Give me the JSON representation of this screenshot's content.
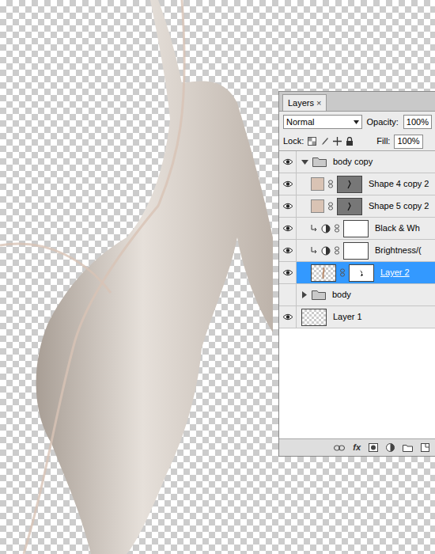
{
  "panel": {
    "tab": "Layers",
    "close": "×",
    "blend_mode": "Normal",
    "opacity_label": "Opacity:",
    "opacity": "100%",
    "lock_label": "Lock:",
    "fill_label": "Fill:",
    "fill": "100%"
  },
  "layers": [
    {
      "name": "body copy",
      "kind": "group",
      "visible": true,
      "expanded": true,
      "selected": false,
      "in_group": false,
      "clipped": false
    },
    {
      "name": "Shape 4 copy 2",
      "kind": "shape",
      "visible": true,
      "expanded": false,
      "selected": false,
      "in_group": true,
      "clipped": false
    },
    {
      "name": "Shape 5 copy 2",
      "kind": "shape",
      "visible": true,
      "expanded": false,
      "selected": false,
      "in_group": true,
      "clipped": false
    },
    {
      "name": "Black & Wh",
      "kind": "adjustment",
      "visible": true,
      "expanded": false,
      "selected": false,
      "in_group": true,
      "clipped": true
    },
    {
      "name": "Brightness/(",
      "kind": "adjustment",
      "visible": true,
      "expanded": false,
      "selected": false,
      "in_group": true,
      "clipped": true
    },
    {
      "name": "Layer 2",
      "kind": "pixel",
      "visible": true,
      "expanded": false,
      "selected": true,
      "in_group": true,
      "clipped": false
    },
    {
      "name": "body",
      "kind": "group",
      "visible": false,
      "expanded": false,
      "selected": false,
      "in_group": false,
      "clipped": false
    },
    {
      "name": "Layer 1",
      "kind": "pixel",
      "visible": true,
      "expanded": false,
      "selected": false,
      "in_group": false,
      "clipped": false
    }
  ],
  "footer": {
    "fx": "fx"
  }
}
